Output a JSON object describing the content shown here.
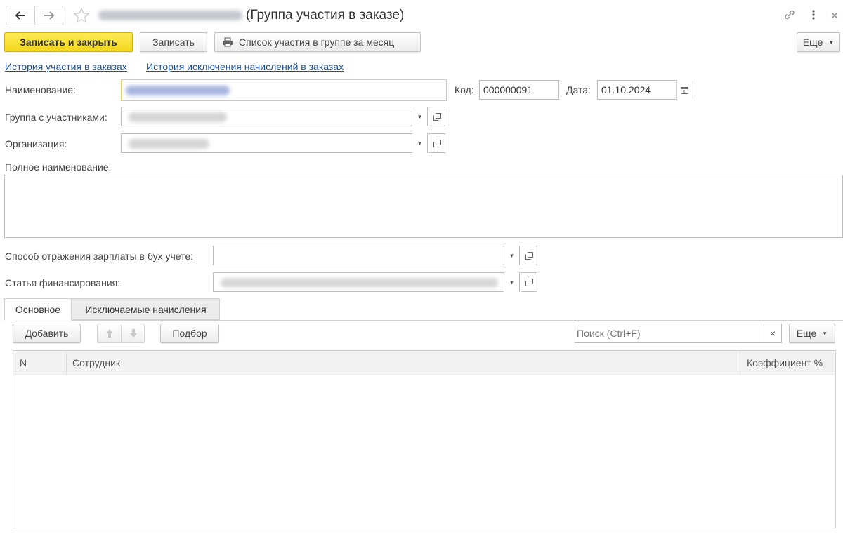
{
  "window": {
    "title_suffix": "(Группа участия в заказе)",
    "back_icon": "arrow-left-icon",
    "forward_icon": "arrow-right-icon",
    "favorite_icon": "star-icon",
    "link_icon": "link-icon",
    "menu_icon": "more-vertical-icon",
    "close_icon": "close-icon"
  },
  "toolbar": {
    "save_close_label": "Записать и закрыть",
    "save_label": "Записать",
    "print_list_label": "Список участия в группе за месяц",
    "more_label": "Еще"
  },
  "links": {
    "history_participation": "История участия в заказах",
    "history_exclusion": "История исключения начислений в заказах"
  },
  "form": {
    "name_label": "Наименование:",
    "code_label": "Код:",
    "code_value": "000000091",
    "date_label": "Дата:",
    "date_value": "01.10.2024",
    "group_label": "Группа с участниками:",
    "org_label": "Организация:",
    "full_name_label": "Полное наименование:",
    "salary_method_label": "Способ отражения зарплаты в бух учете:",
    "finance_item_label": "Статья финансирования:"
  },
  "tabs": [
    {
      "label": "Основное",
      "active": true
    },
    {
      "label": "Исключаемые начисления",
      "active": false
    }
  ],
  "table_toolbar": {
    "add_label": "Добавить",
    "pick_label": "Подбор",
    "search_placeholder": "Поиск (Ctrl+F)",
    "clear_icon": "×",
    "more_label": "Еще"
  },
  "table": {
    "columns": [
      "N",
      "Сотрудник",
      "Коэффициент %"
    ],
    "rows": []
  },
  "colors": {
    "primary_button": "#f5d824",
    "link": "#1a4f96",
    "active_field_border": "#e8cf5a"
  }
}
